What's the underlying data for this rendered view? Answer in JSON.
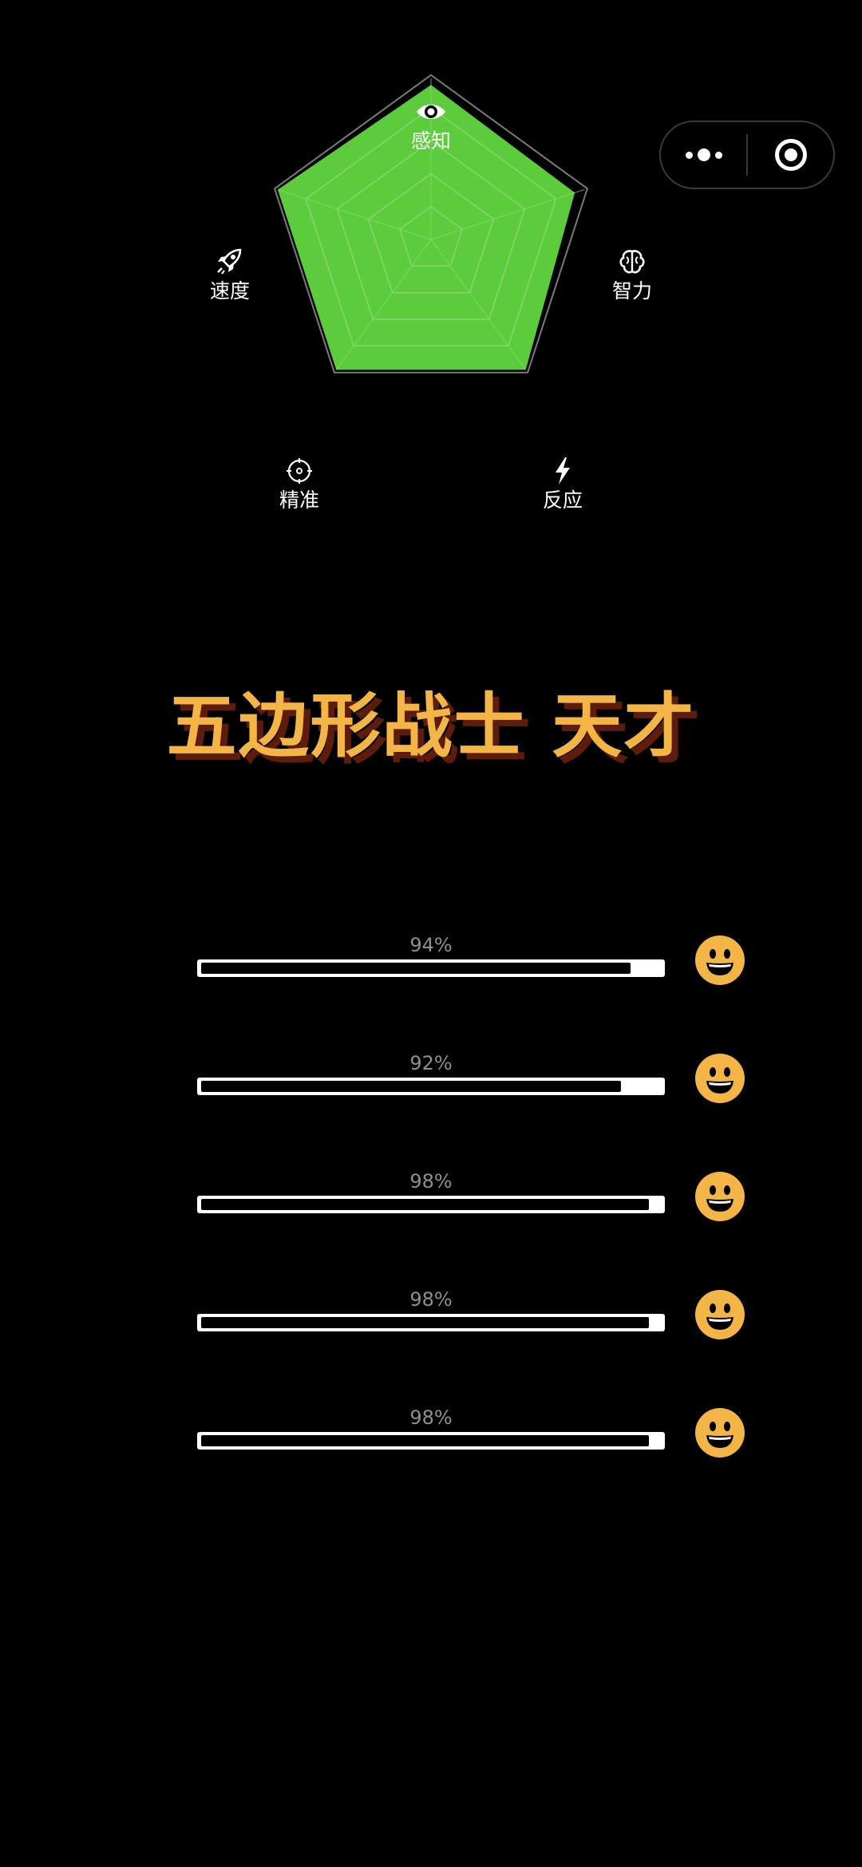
{
  "radar": {
    "axes": [
      {
        "key": "perception",
        "label": "感知",
        "icon": "eye-icon",
        "value": 0.94
      },
      {
        "key": "intelligence",
        "label": "智力",
        "icon": "brain-icon",
        "value": 0.92
      },
      {
        "key": "reaction",
        "label": "反应",
        "icon": "lightning-icon",
        "value": 0.98
      },
      {
        "key": "precision",
        "label": "精准",
        "icon": "crosshair-icon",
        "value": 0.98
      },
      {
        "key": "speed",
        "label": "速度",
        "icon": "rocket-icon",
        "value": 0.98
      }
    ],
    "fill_color": "#5ccc3c",
    "grid_color": "#8fd97a",
    "outline_color": "#7a7a7a",
    "levels": 5
  },
  "title": "五边形战士 天才",
  "title_color": "#f3b545",
  "title_shadow_color": "#5e1d0c",
  "stats": [
    {
      "label": "94%",
      "value": 0.94,
      "icon": "smiley-icon"
    },
    {
      "label": "92%",
      "value": 0.92,
      "icon": "smiley-icon"
    },
    {
      "label": "98%",
      "value": 0.98,
      "icon": "smiley-icon"
    },
    {
      "label": "98%",
      "value": 0.98,
      "icon": "smiley-icon"
    },
    {
      "label": "98%",
      "value": 0.98,
      "icon": "smiley-icon"
    }
  ],
  "colors": {
    "background": "#000000",
    "smiley": "#f3b545",
    "bar": "#ffffff",
    "percent_text": "#8f8f8f"
  }
}
